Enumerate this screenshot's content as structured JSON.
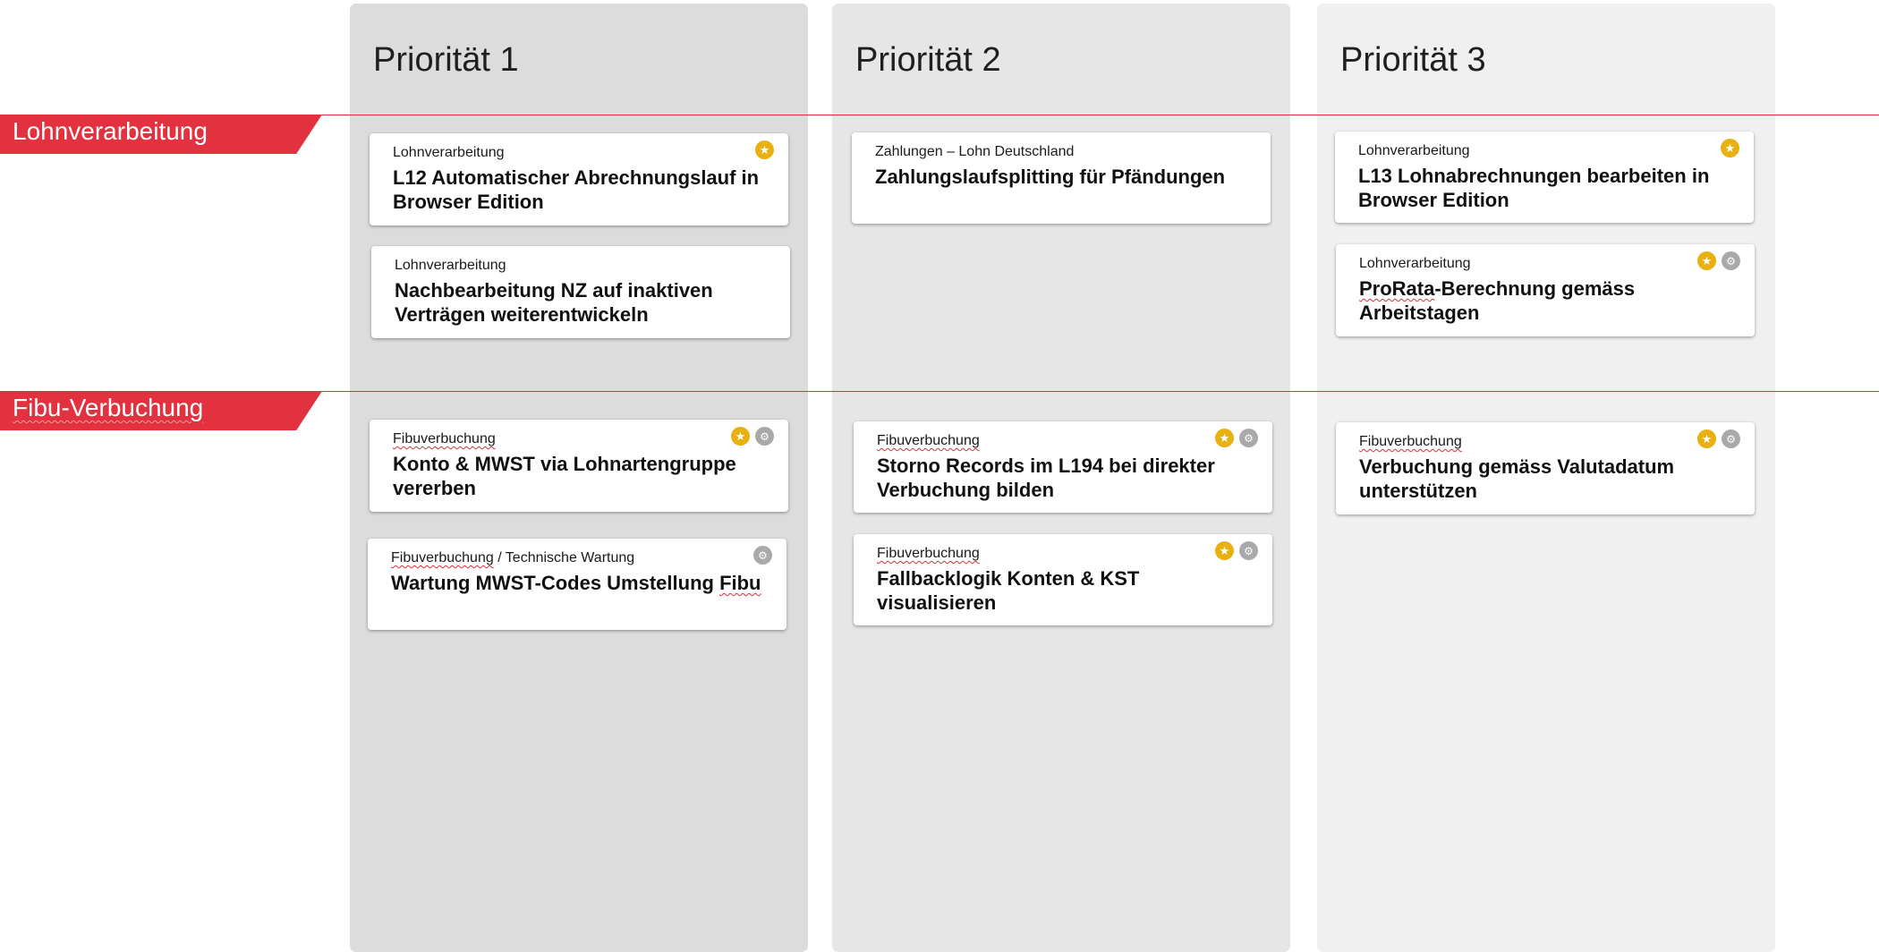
{
  "columns": [
    {
      "title": "Priorität 1"
    },
    {
      "title": "Priorität 2"
    },
    {
      "title": "Priorität 3"
    }
  ],
  "lanes": [
    {
      "label": "Lohnverarbeitung"
    },
    {
      "label": "Fibu-Verbuchung"
    }
  ],
  "icons": {
    "star": "star-icon",
    "settings": "gear-icon"
  },
  "colors": {
    "accent": "#e2313f",
    "star": "#e8b111",
    "icon_gray": "#a9a9a9"
  },
  "cards": {
    "c1": {
      "category": "Lohnverarbeitung",
      "title": "L12 Automatischer Abrechnungslauf in Browser Edition"
    },
    "c2": {
      "category": "Lohnverarbeitung",
      "title": "Nachbearbeitung NZ auf inaktiven Verträgen weiterentwickeln"
    },
    "c3": {
      "category": "Zahlungen – Lohn Deutschland",
      "title": "Zahlungslaufsplitting für Pfändungen"
    },
    "c4": {
      "category": "Lohnverarbeitung",
      "title": "L13 Lohnabrechnungen bearbeiten in Browser Edition"
    },
    "c5": {
      "category": "Lohnverarbeitung",
      "title_a": "ProRata",
      "title_b": "-Berechnung gemäss Arbeitstagen"
    },
    "c6": {
      "category": "Fibuverbuchung",
      "title": "Konto & MWST via Lohnartengruppe vererben"
    },
    "c7": {
      "category_a": "Fibuverbuchung",
      "category_b": " / Technische Wartung",
      "title_a": "Wartung MWST-Codes Umstellung ",
      "title_b": "Fibu"
    },
    "c8": {
      "category": "Fibuverbuchung",
      "title": "Storno Records im L194 bei direkter Verbuchung bilden"
    },
    "c9": {
      "category": "Fibuverbuchung",
      "title": "Fallbacklogik Konten & KST visualisieren"
    },
    "c10": {
      "category": "Fibuverbuchung",
      "title": "Verbuchung gemäss Valutadatum unterstützen"
    }
  }
}
